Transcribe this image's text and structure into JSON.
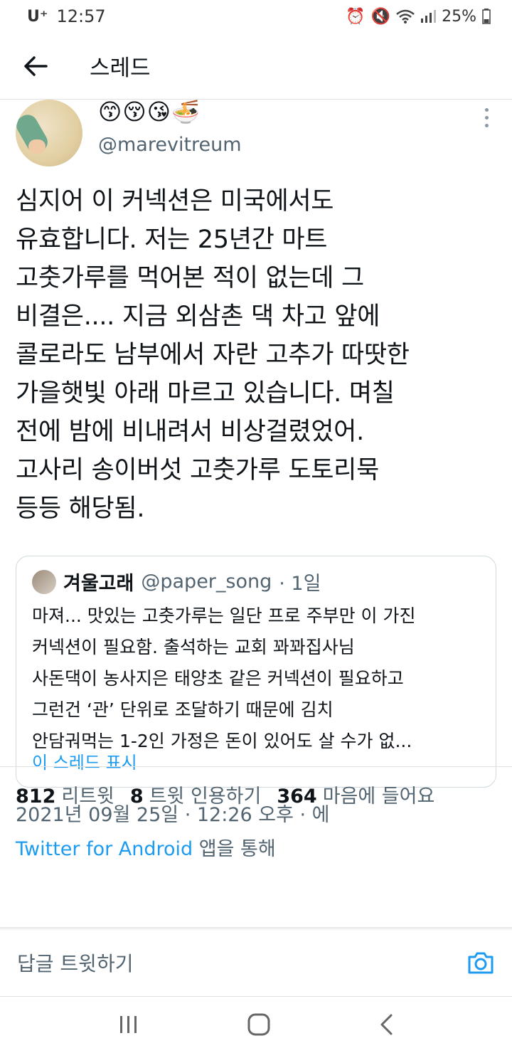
{
  "status_bar": {
    "carrier": "U⁺",
    "time": "12:57",
    "battery": "25%"
  },
  "app_bar": {
    "title": "스레드"
  },
  "tweet": {
    "display_name": "😙😚😘🍜",
    "handle": "@marevitreum",
    "text": "심지어 이 커넥션은 미국에서도\n유효합니다. 저는 25년간 마트\n고춧가루를 먹어본 적이 없는데 그\n비결은.... 지금 외삼촌 댁 차고 앞에\n콜로라도 남부에서 자란 고추가 따땃한\n가을햇빛 아래 마르고 있습니다. 며칠\n전에 밤에 비내려서 비상걸렸었어.\n고사리 송이버섯 고춧가루 도토리묵\n등등 해당됨.",
    "quote": {
      "name": "겨울고래",
      "handle": "@paper_song",
      "age": "· 1일",
      "text": "마져... 맛있는 고춧가루는 일단 프로 주부만 이 가진\n커넥션이 필요함. 출석하는 교회 꽈꽈집사님\n사돈댁이 농사지은 태양초 같은 커넥션이 필요하고\n그런건 ‘관’ 단위로 조달하기 때문에 김치\n안담궈먹는 1-2인 가정은 돈이 있어도 살 수가 없...",
      "show_thread": "이 스레드 표시"
    },
    "timestamp": "2021년 09월 25일 · 12:26 오후 · 에",
    "source_app": "Twitter for Android",
    "source_suffix": "앱을 통해",
    "stats": {
      "retweets_count": "812",
      "retweets_label": "리트윗",
      "quotes_count": "8",
      "quotes_label": "트윗 인용하기",
      "likes_count": "364",
      "likes_label": "마음에 들어요"
    }
  },
  "reply": {
    "placeholder": "답글 트윗하기"
  },
  "icons": {
    "back": "arrow-left-icon",
    "more": "more-vertical-icon",
    "camera": "camera-icon",
    "nav_recent": "recent-apps-icon",
    "nav_home": "home-icon",
    "nav_back": "nav-back-icon"
  },
  "colors": {
    "accent": "#1d9bf0",
    "secondary_text": "#536471"
  }
}
